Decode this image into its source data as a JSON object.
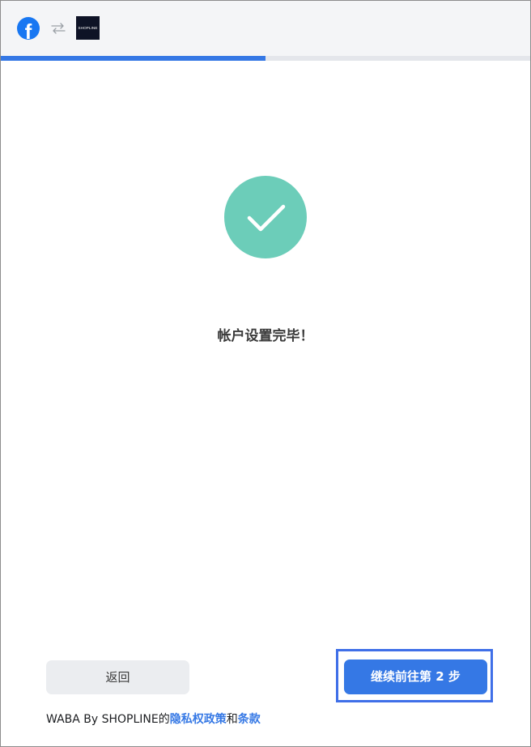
{
  "header": {
    "facebook_logo_letter": "f",
    "swap_icon": "swap-arrows-icon",
    "shopline_logo_text": "SHOPLINE"
  },
  "progress": {
    "fraction": 0.5,
    "color": "#3578e5"
  },
  "status": {
    "icon": "check-icon",
    "circle_color": "#6ccdb9",
    "message": "帐户设置完毕！"
  },
  "actions": {
    "back_label": "返回",
    "continue_label": "继续前往第 2 步"
  },
  "footer": {
    "prefix": "WABA By SHOPLINE的",
    "privacy_link": "隐私权政策",
    "connector": "和",
    "terms_link": "条款"
  },
  "colors": {
    "primary": "#3578e5",
    "success": "#6ccdb9",
    "facebook": "#1877f2",
    "highlight": "#3f6fe8"
  }
}
